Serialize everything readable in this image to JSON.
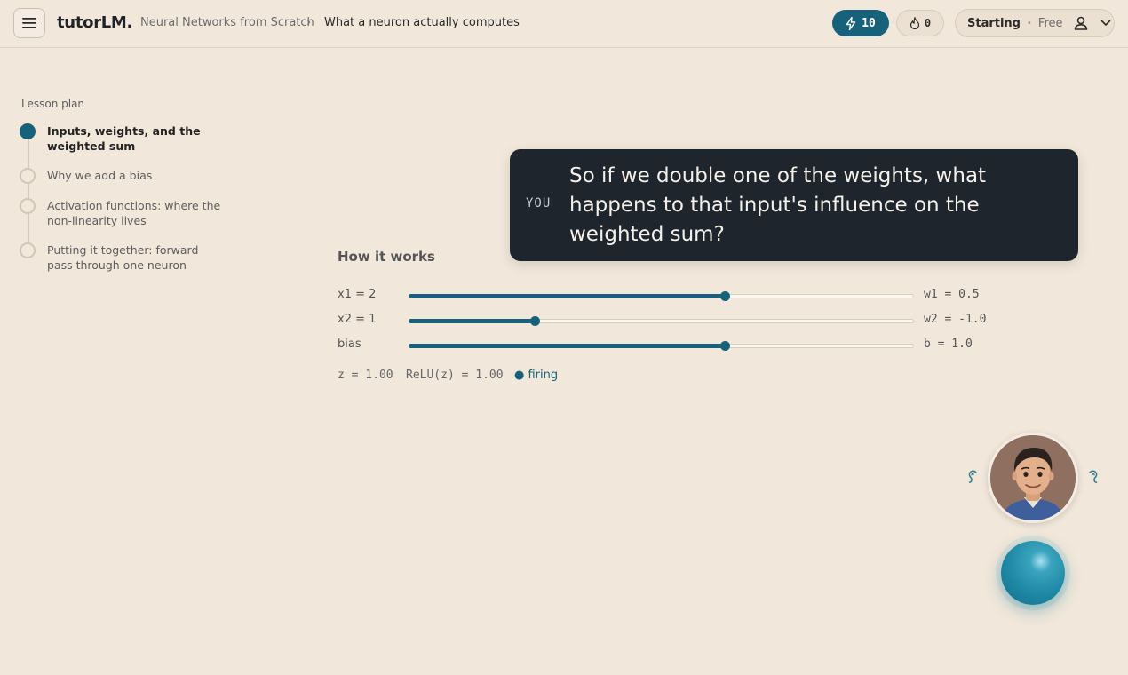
{
  "header": {
    "menu_icon": "hamburger-icon",
    "logo": "tutorLM.",
    "breadcrumb": {
      "course": "Neural Networks from Scratch",
      "separator": "›",
      "lesson": "What a neuron actually computes"
    },
    "energy": {
      "icon": "lightning-icon",
      "value": "10",
      "color": "#17627a"
    },
    "streak": {
      "icon": "flame-icon",
      "value": "0"
    },
    "plan": {
      "level": "Starting",
      "dot": "•",
      "tier": "Free",
      "icon": "user-icon",
      "chevron": "chevron-down-icon"
    }
  },
  "sidebar": {
    "title": "Lesson plan",
    "steps": [
      {
        "label": "Inputs, weights, and the weighted sum",
        "active": true
      },
      {
        "label": "Why we add a bias",
        "active": false
      },
      {
        "label": "Activation functions: where the non-linearity lives",
        "active": false
      },
      {
        "label": "Putting it together: forward pass through one neuron",
        "active": false
      }
    ]
  },
  "bubble": {
    "speaker": "YOU",
    "message": "So if we double one of the weights, what happens to that input's influence on the weighted sum?"
  },
  "widget": {
    "title": "How it works",
    "sliders": [
      {
        "label": "x1 = 2",
        "value_label": "w1 = 0.5",
        "fraction": 0.625
      },
      {
        "label": "x2 = 1",
        "value_label": "w2 = -1.0",
        "fraction": 0.25
      },
      {
        "label": "bias",
        "value_label": "b = 1.0",
        "fraction": 0.625
      }
    ],
    "results": {
      "z": "z = 1.00",
      "relu": "ReLU(z) = 1.00",
      "status": "● firing"
    }
  },
  "tutor": {
    "avatar": "tutor-avatar",
    "left_icon": "ear-icon",
    "right_icon": "ear-icon",
    "orb": "voice-orb",
    "accent": "#17627a"
  }
}
